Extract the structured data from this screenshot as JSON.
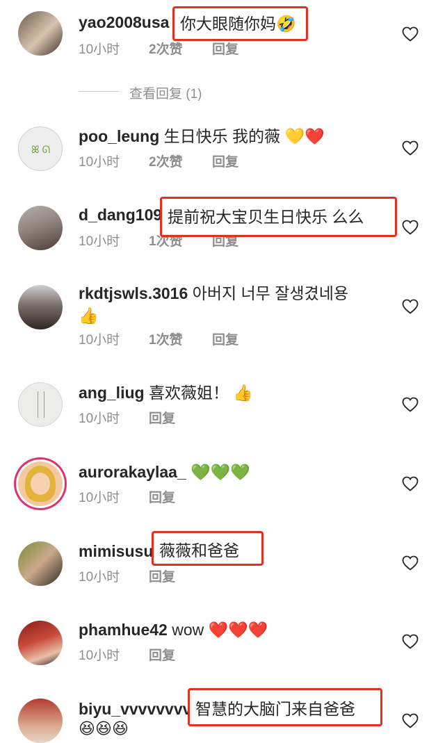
{
  "view_replies_label": "查看回复 (1)",
  "comments": [
    {
      "username": "yao2008usa",
      "text": "你大眼随你妈🤣",
      "time": "10小时",
      "likes": "2次赞",
      "reply": "回复"
    },
    {
      "username": "poo_leung",
      "text": "生日快乐 我的薇 💛❤️",
      "time": "10小时",
      "likes": "2次赞",
      "reply": "回复"
    },
    {
      "username": "d_dang109",
      "text": "提前祝大宝贝生日快乐 么么",
      "time": "10小时",
      "likes": "1次赞",
      "reply": "回复"
    },
    {
      "username": "rkdtjswls.3016",
      "text": "아버지 너무 잘생겼네용",
      "text2": "👍",
      "time": "10小时",
      "likes": "1次赞",
      "reply": "回复"
    },
    {
      "username": "ang_liug",
      "text": "喜欢薇姐！ 👍",
      "time": "10小时",
      "reply": "回复"
    },
    {
      "username": "aurorakaylaa_",
      "text": "💚💚💚",
      "time": "10小时",
      "reply": "回复"
    },
    {
      "username": "mimisusu",
      "text": "薇薇和爸爸",
      "time": "10小时",
      "reply": "回复"
    },
    {
      "username": "phamhue42",
      "text": "wow ❤️❤️❤️",
      "time": "10小时",
      "reply": "回复"
    },
    {
      "username": "biyu_vvvvvvvv",
      "text": "智慧的大脑门来自爸爸",
      "text2": "😆😆😆"
    }
  ],
  "colors": {
    "highlight_box": "#e0311e",
    "meta_text": "#8e8e8e",
    "story_ring": "#e1306c"
  },
  "icons": {
    "like": "heart-outline-icon"
  }
}
